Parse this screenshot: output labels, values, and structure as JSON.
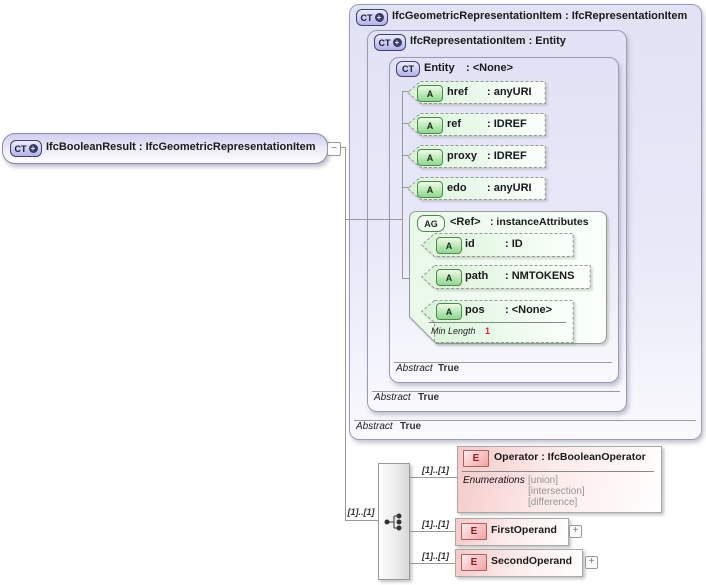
{
  "icons": {
    "complex_type": "CT",
    "attribute": "A",
    "attribute_group": "AG",
    "element": "E",
    "plus_badge": "+",
    "collapse": "−",
    "expand": "+"
  },
  "colors": {
    "complex_type_lavender": "#e3e3f7",
    "attribute_green": "#ddf6dd",
    "element_pink": "#f5caca",
    "facet_value_red": "#dd2222"
  },
  "root_node": {
    "label": "IfcBooleanResult : IfcGeometricRepresentationItem"
  },
  "outer_box": {
    "title": "IfcGeometricRepresentationItem : IfcRepresentationItem",
    "abstract_label": "Abstract",
    "abstract_value": "True"
  },
  "middle_box": {
    "title": "IfcRepresentationItem : Entity",
    "abstract_label": "Abstract",
    "abstract_value": "True"
  },
  "entity_box": {
    "name": "Entity",
    "type": ": <None>",
    "abstract_label": "Abstract",
    "abstract_value": "True",
    "attributes": [
      {
        "name": "href",
        "type": ": anyURI"
      },
      {
        "name": "ref",
        "type": ": IDREF"
      },
      {
        "name": "proxy",
        "type": ": IDREF"
      },
      {
        "name": "edo",
        "type": ": anyURI"
      }
    ]
  },
  "ref_group": {
    "name": "<Ref>",
    "type": ": instanceAttributes",
    "attributes": [
      {
        "name": "id",
        "type": ": ID"
      },
      {
        "name": "path",
        "type": ": NMTOKENS"
      },
      {
        "name": "pos",
        "type": ": <None>",
        "facet_label": "Min Length",
        "facet_value": "1"
      }
    ]
  },
  "content_model": {
    "cardinality": "[1]..[1]",
    "children": [
      {
        "name": "Operator : IfcBooleanOperator",
        "cardinality": "[1]..[1]",
        "enumerations_label": "Enumerations",
        "enumerations": [
          "[union]",
          "[intersection]",
          "[difference]"
        ]
      },
      {
        "name": "FirstOperand",
        "cardinality": "[1]..[1]"
      },
      {
        "name": "SecondOperand",
        "cardinality": "[1]..[1]"
      }
    ]
  }
}
